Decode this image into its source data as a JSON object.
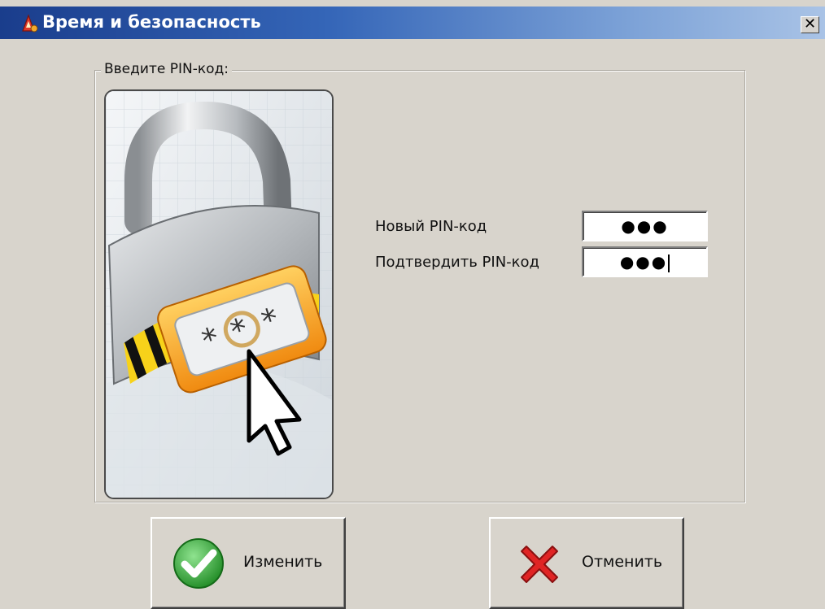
{
  "window": {
    "title": "Время и безопасность",
    "close_glyph": "✕"
  },
  "group": {
    "legend": "Введите PIN-код:"
  },
  "form": {
    "new_pin_label": "Новый PIN-код",
    "new_pin_value": "●●●",
    "confirm_pin_label": "Подтвердить PIN-код",
    "confirm_pin_value": "●●●"
  },
  "buttons": {
    "change_label": "Изменить",
    "cancel_label": "Отменить"
  },
  "colors": {
    "titlebar": "#1a3d8c",
    "ok_green": "#2e9a2e",
    "cancel_red": "#d42020",
    "accent_yellow": "#f0c000"
  },
  "icons": {
    "app": "security-app-icon",
    "art": "padlock-pin-illustration",
    "ok": "checkmark-icon",
    "cancel": "cross-icon"
  }
}
